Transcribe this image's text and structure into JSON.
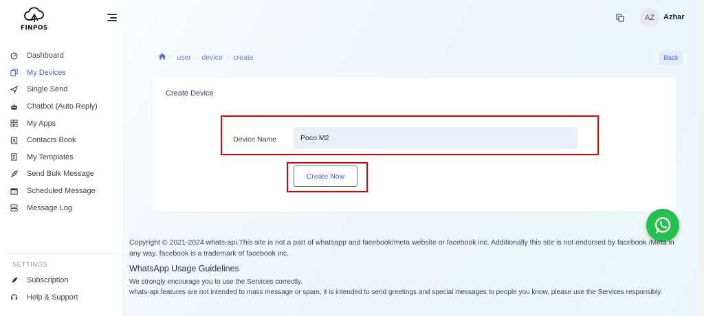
{
  "brand": {
    "logo_text": "FINPOS"
  },
  "sidebar": {
    "items": [
      {
        "label": "Dashboard",
        "icon": "dashboard-icon",
        "active": false
      },
      {
        "label": "My Devices",
        "icon": "devices-icon",
        "active": true
      },
      {
        "label": "Single Send",
        "icon": "send-icon",
        "active": false
      },
      {
        "label": "Chatbot (Auto Reply)",
        "icon": "robot-icon",
        "active": false
      },
      {
        "label": "My Apps",
        "icon": "apps-icon",
        "active": false
      },
      {
        "label": "Contacts Book",
        "icon": "contacts-icon",
        "active": false
      },
      {
        "label": "My Templates",
        "icon": "templates-icon",
        "active": false
      },
      {
        "label": "Send Bulk Message",
        "icon": "rocket-icon",
        "active": false
      },
      {
        "label": "Scheduled Message",
        "icon": "calendar-icon",
        "active": false
      },
      {
        "label": "Message Log",
        "icon": "log-icon",
        "active": false
      }
    ],
    "settings_label": "SETTINGS",
    "settings_items": [
      {
        "label": "Subscription",
        "icon": "subscription-icon"
      },
      {
        "label": "Help & Support",
        "icon": "support-icon"
      }
    ]
  },
  "topbar": {
    "avatar_initials": "AZ",
    "username": "Azhar"
  },
  "breadcrumb": {
    "items": [
      "user",
      "device",
      "create"
    ]
  },
  "back_label": "Back",
  "form": {
    "title": "Create Device",
    "device_name_label": "Device Name",
    "device_name_value": "Poco M2",
    "submit_label": "Create Now"
  },
  "footer": {
    "copyright": "Copyright © 2021-2024 whats-api.This site is not a part of whatsapp and facebook/meta website or facebook inc. Additionally this site is not endorsed by facebook /Meta in any way. facebook is a trademark of facebook inc.",
    "guidelines_title": "WhatsApp Usage Guidelines",
    "guidelines_line1": "We strongly encourage you to use the Services correctly.",
    "guidelines_line2": "whats-api features are not intended to mass message or spam, it is intended to send greetings and special messages to people you know, please use the Services responsibly."
  },
  "colors": {
    "accent": "#4a64c9",
    "highlight_border": "#e00000",
    "whatsapp_green": "#25c04e"
  }
}
